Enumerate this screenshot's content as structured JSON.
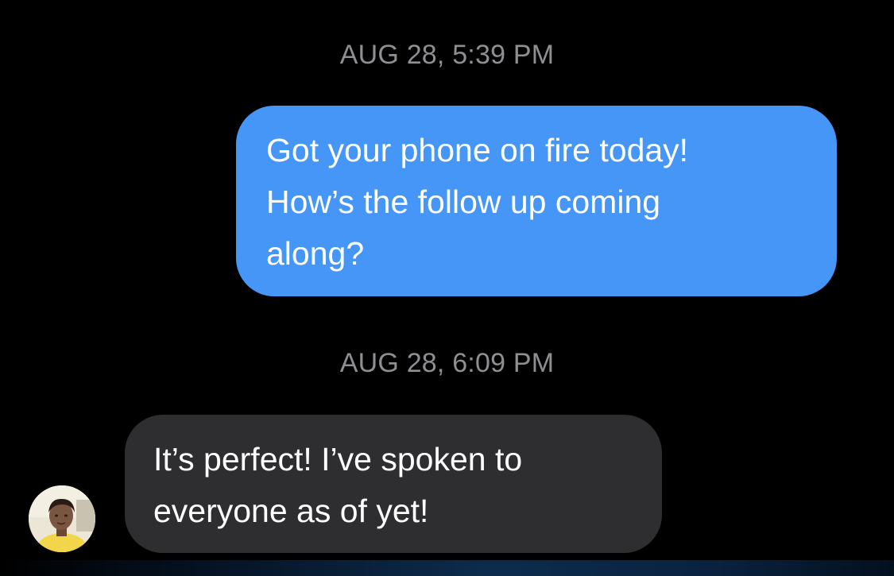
{
  "thread": {
    "messages": [
      {
        "timestamp": "AUG 28, 5:39 PM",
        "direction": "sent",
        "text": "Got your phone on fire today!\nHow’s the follow up coming\nalong?"
      },
      {
        "timestamp": "AUG 28, 6:09 PM",
        "direction": "received",
        "text": "It’s perfect! I’ve spoken to\neveryone as of yet!",
        "avatar_icon": "contact-avatar-photo"
      }
    ]
  },
  "colors": {
    "background": "#000000",
    "sent_bubble": "#4596f7",
    "received_bubble": "#2e2e30",
    "timestamp_text": "#8e8e93",
    "message_text": "#ffffff"
  }
}
